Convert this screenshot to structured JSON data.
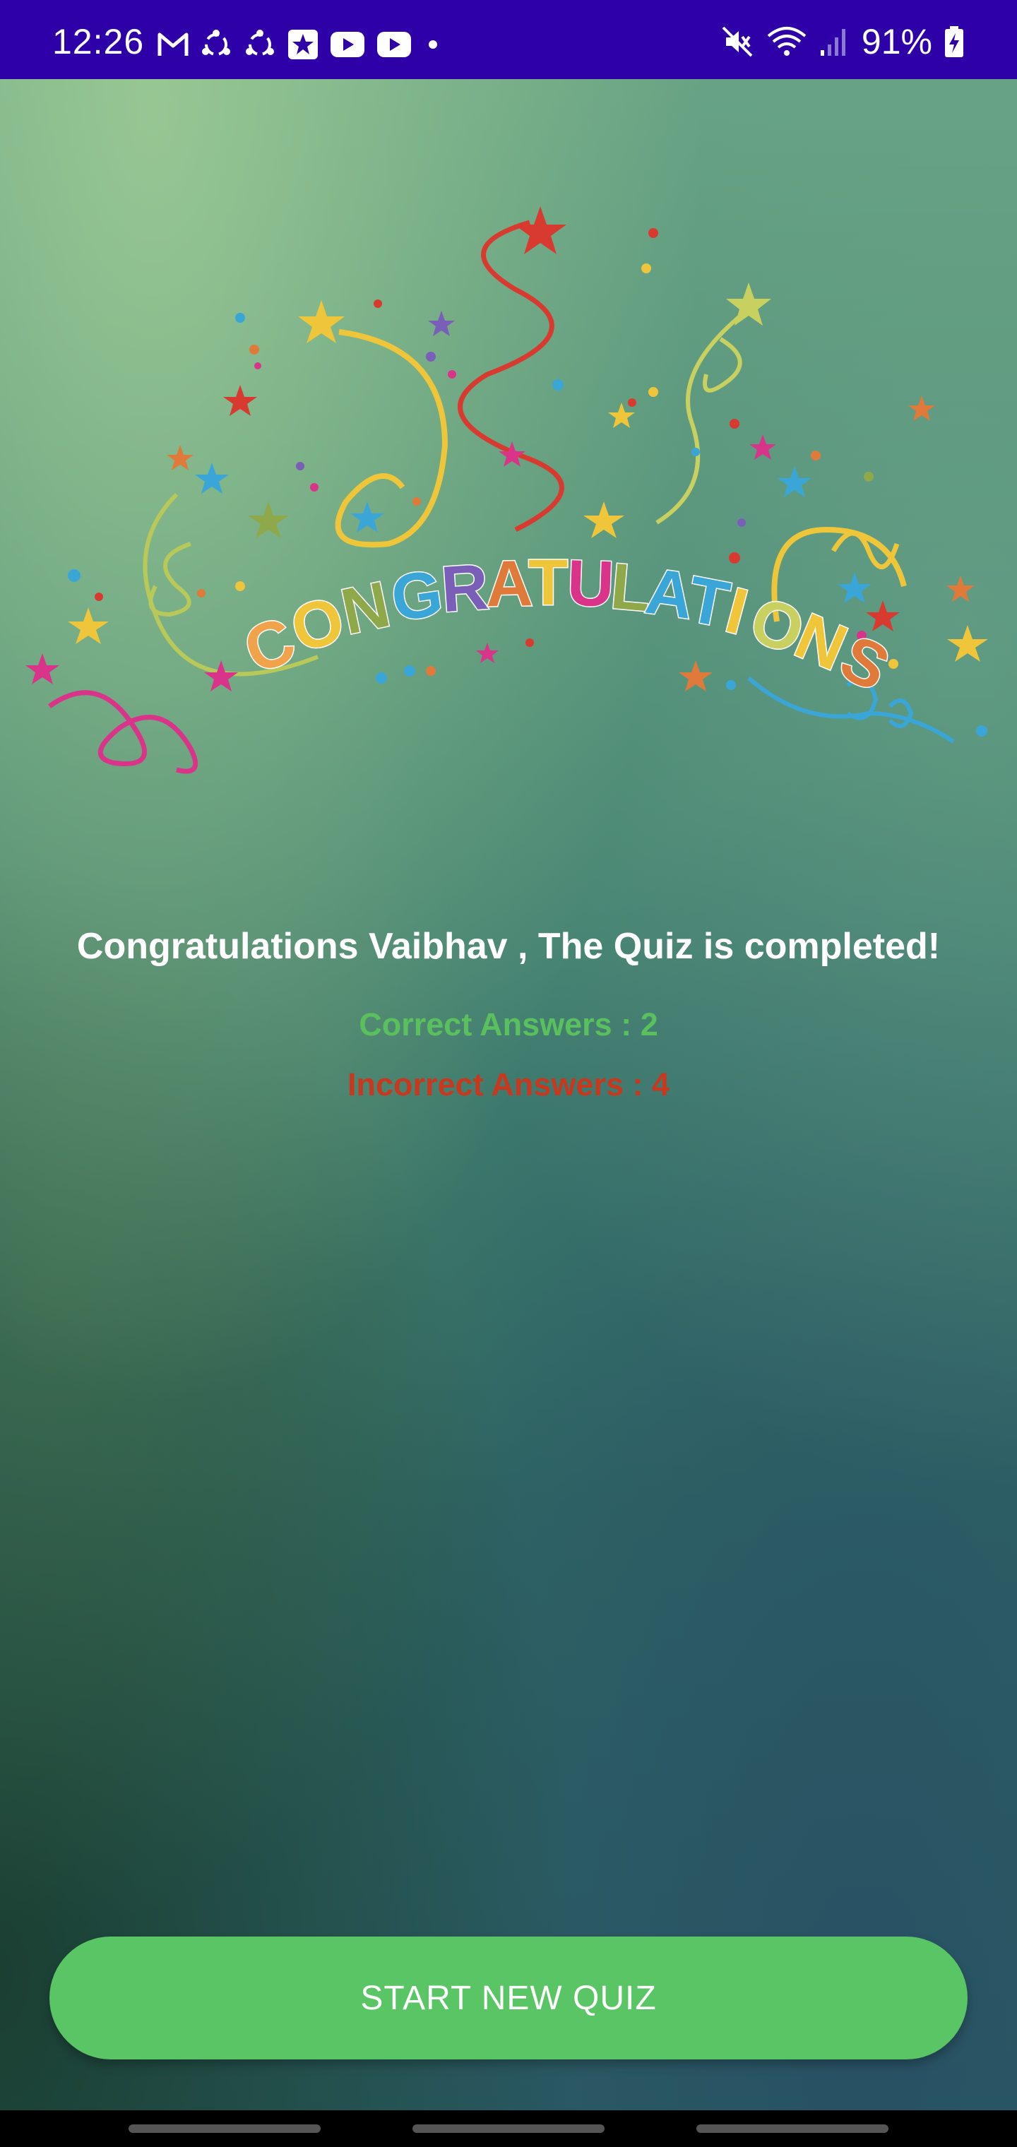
{
  "status_bar": {
    "time": "12:26",
    "battery": "91%",
    "left_icons": [
      "gmail-icon",
      "sync-icon",
      "sync-icon",
      "app-star-icon",
      "youtube-icon",
      "youtube-icon",
      "dot-icon"
    ],
    "right_icons": [
      "mute-icon",
      "wifi-icon",
      "signal-icon",
      "battery-icon"
    ],
    "color": "#2e00a8"
  },
  "banner": {
    "text": "CONGRATULATIONS"
  },
  "result": {
    "title": "Congratulations Vaibhav , The Quiz is completed!",
    "correct": "Correct Answers : 2",
    "incorrect": "Incorrect Answers : 4",
    "correct_color": "#5ac05e",
    "incorrect_color": "#c8381e"
  },
  "actions": {
    "start_new_quiz": "START NEW QUIZ",
    "button_color": "#5ac565"
  }
}
